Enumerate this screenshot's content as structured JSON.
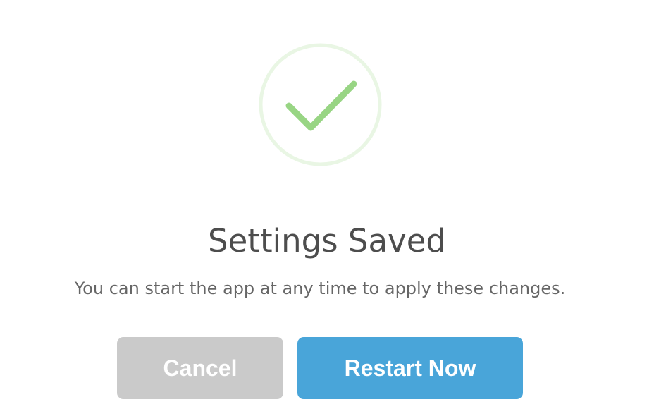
{
  "dialog": {
    "title": "Settings Saved",
    "message": "You can start the app at any time to apply these changes.",
    "status_icon": "check-circle-icon",
    "colors": {
      "check": "#98d584",
      "ring": "#e9f6e4",
      "title": "#4d4d4d",
      "message": "#666666",
      "cancel_bg": "#cacaca",
      "restart_bg": "#49a5d9"
    }
  },
  "actions": {
    "cancel_label": "Cancel",
    "restart_label": "Restart Now"
  }
}
